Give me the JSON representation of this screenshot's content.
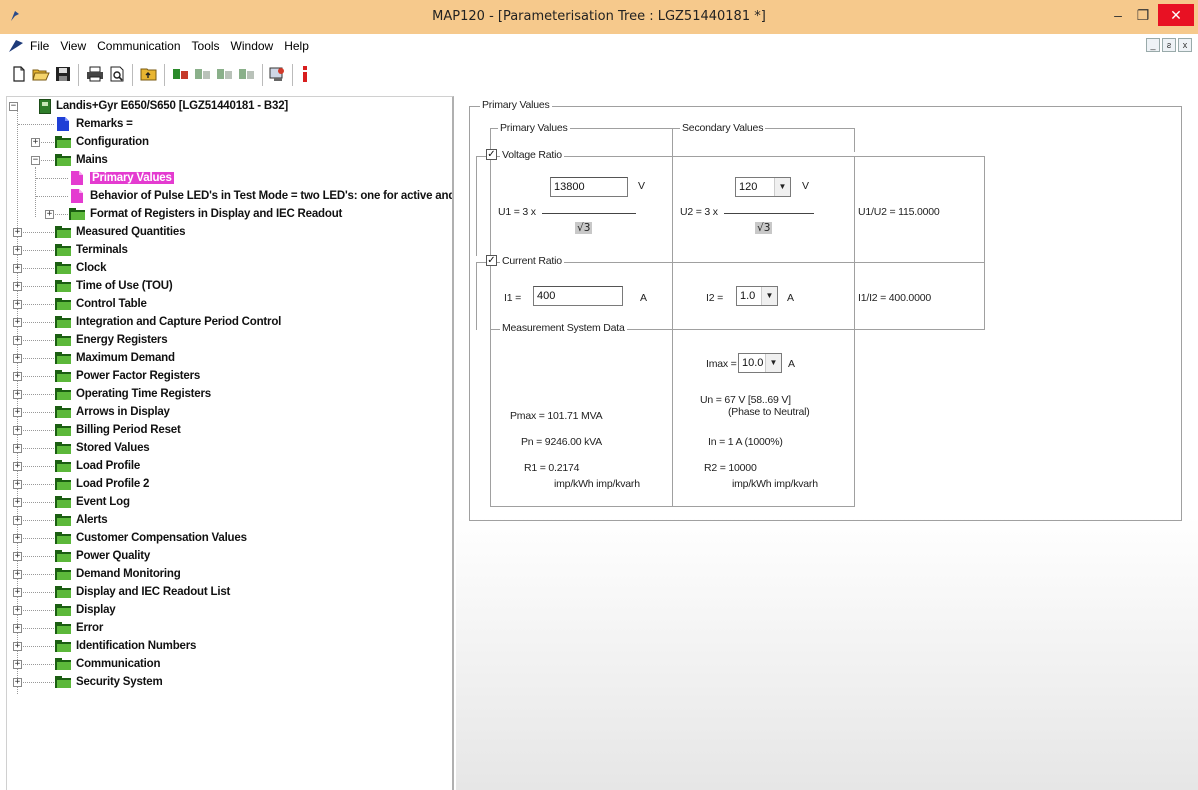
{
  "window": {
    "title": "MAP120 - [Parameterisation Tree : LGZ51440181 *]",
    "minimize": "–",
    "maximize": "❐",
    "close": "✕"
  },
  "menu": {
    "items": [
      "File",
      "View",
      "Communication",
      "Tools",
      "Window",
      "Help"
    ],
    "mdi": [
      "_",
      "ƨ",
      "x"
    ]
  },
  "tree": {
    "root": "Landis+Gyr E650/S650 [LGZ51440181 - B32]",
    "remarks": "Remarks =",
    "configuration": "Configuration",
    "mains": "Mains",
    "primary_values": "Primary Values",
    "pulse_leds": "Behavior of Pulse LED's in Test Mode = two LED's: one for active and c",
    "format_registers": "Format of Registers in Display and IEC Readout",
    "items": [
      "Measured Quantities",
      "Terminals",
      "Clock",
      "Time of Use (TOU)",
      "Control Table",
      "Integration and Capture Period Control",
      "Energy Registers",
      "Maximum Demand",
      "Power Factor Registers",
      "Operating Time Registers",
      "Arrows in Display",
      "Billing Period Reset",
      "Stored Values",
      "Load Profile",
      "Load Profile 2",
      "Event Log",
      "Alerts",
      "Customer Compensation Values",
      "Power Quality",
      "Demand Monitoring",
      "Display and IEC Readout List",
      "Display",
      "Error",
      "Identification Numbers",
      "Communication",
      "Security System"
    ]
  },
  "panel": {
    "group_title": "Primary Values",
    "col_primary": "Primary Values",
    "col_secondary": "Secondary Values",
    "voltage_ratio_label": "Voltage Ratio",
    "voltage_ratio_checked": true,
    "u1_value": "13800",
    "u1_unit": "V",
    "u1_label": "U1 = 3 x",
    "sqrt3": "√3",
    "u2_value": "120",
    "u2_unit": "V",
    "u2_label": "U2 = 3 x",
    "u_ratio": "U1/U2 = 115.0000",
    "current_ratio_label": "Current Ratio",
    "current_ratio_checked": true,
    "i1_label": "I1 =",
    "i1_value": "400",
    "i1_unit": "A",
    "i2_label": "I2 =",
    "i2_value": "1.0",
    "i2_unit": "A",
    "i_ratio": "I1/I2 = 400.0000",
    "msd_title": "Measurement System Data",
    "imax_label": "Imax =",
    "imax_value": "10.0",
    "imax_unit": "A",
    "un_text": "Un =  67 V [58..69 V]",
    "phase_text": "(Phase to Neutral)",
    "pmax_text": "Pmax =  101.71 MVA",
    "pn_text": "Pn =  9246.00 kVA",
    "in_text": "In =  1 A (1000%)",
    "r1_text": "R1 =  0.2174",
    "r1_unit": "imp/kWh  imp/kvarh",
    "r2_text": "R2 =  10000",
    "r2_unit": "imp/kWh  imp/kvarh",
    "checkmark": "✓",
    "dropdown_arrow": "▼"
  },
  "colors": {
    "titlebar": "#f6c98c",
    "close": "#e81123",
    "selection": "#e43bd0",
    "folder_dark": "#1b5e12",
    "folder_light": "#5cb83a"
  }
}
